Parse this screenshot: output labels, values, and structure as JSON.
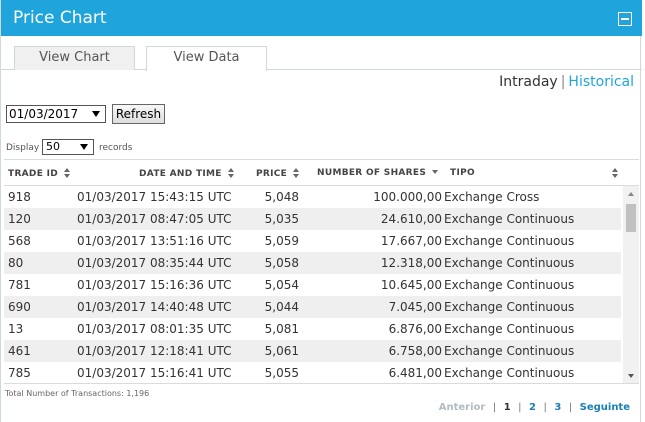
{
  "panel": {
    "title": "Price Chart"
  },
  "tabs": [
    {
      "label": "View Chart"
    },
    {
      "label": "View Data"
    }
  ],
  "mode": {
    "intraday": "Intraday",
    "separator": "|",
    "historical": "Historical"
  },
  "filters": {
    "date_value": "01/03/2017",
    "refresh_label": "Refresh",
    "display_label": "Display",
    "page_size": "50",
    "records_label": "records"
  },
  "table": {
    "columns": [
      "TRADE ID",
      "DATE AND TIME",
      "PRICE",
      "NUMBER OF SHARES",
      "TIPO"
    ],
    "rows": [
      {
        "trade_id": "918",
        "datetime": "01/03/2017 15:43:15 UTC",
        "price": "5,048",
        "shares": "100.000,00",
        "tipo": "Exchange Cross"
      },
      {
        "trade_id": "120",
        "datetime": "01/03/2017 08:47:05 UTC",
        "price": "5,035",
        "shares": "24.610,00",
        "tipo": "Exchange Continuous"
      },
      {
        "trade_id": "568",
        "datetime": "01/03/2017 13:51:16 UTC",
        "price": "5,059",
        "shares": "17.667,00",
        "tipo": "Exchange Continuous"
      },
      {
        "trade_id": "80",
        "datetime": "01/03/2017 08:35:44 UTC",
        "price": "5,058",
        "shares": "12.318,00",
        "tipo": "Exchange Continuous"
      },
      {
        "trade_id": "781",
        "datetime": "01/03/2017 15:16:36 UTC",
        "price": "5,054",
        "shares": "10.645,00",
        "tipo": "Exchange Continuous"
      },
      {
        "trade_id": "690",
        "datetime": "01/03/2017 14:40:48 UTC",
        "price": "5,044",
        "shares": "7.045,00",
        "tipo": "Exchange Continuous"
      },
      {
        "trade_id": "13",
        "datetime": "01/03/2017 08:01:35 UTC",
        "price": "5,081",
        "shares": "6.876,00",
        "tipo": "Exchange Continuous"
      },
      {
        "trade_id": "461",
        "datetime": "01/03/2017 12:18:41 UTC",
        "price": "5,061",
        "shares": "6.758,00",
        "tipo": "Exchange Continuous"
      },
      {
        "trade_id": "785",
        "datetime": "01/03/2017 15:16:41 UTC",
        "price": "5,055",
        "shares": "6.481,00",
        "tipo": "Exchange Continuous"
      }
    ]
  },
  "footer": {
    "total_text": "Total Number of Transactions: 1,196",
    "pager": {
      "prev": "Anterior",
      "bar": "|",
      "pages": [
        "1",
        "2",
        "3"
      ],
      "next": "Seguinte"
    }
  },
  "colors": {
    "header": "#1fa5dc",
    "link": "#1fa5dc",
    "alt_row": "#efefef"
  },
  "icons": {
    "minimize": "minimize-icon",
    "sort": "sort-icon",
    "sort_desc": "sort-desc-icon"
  }
}
